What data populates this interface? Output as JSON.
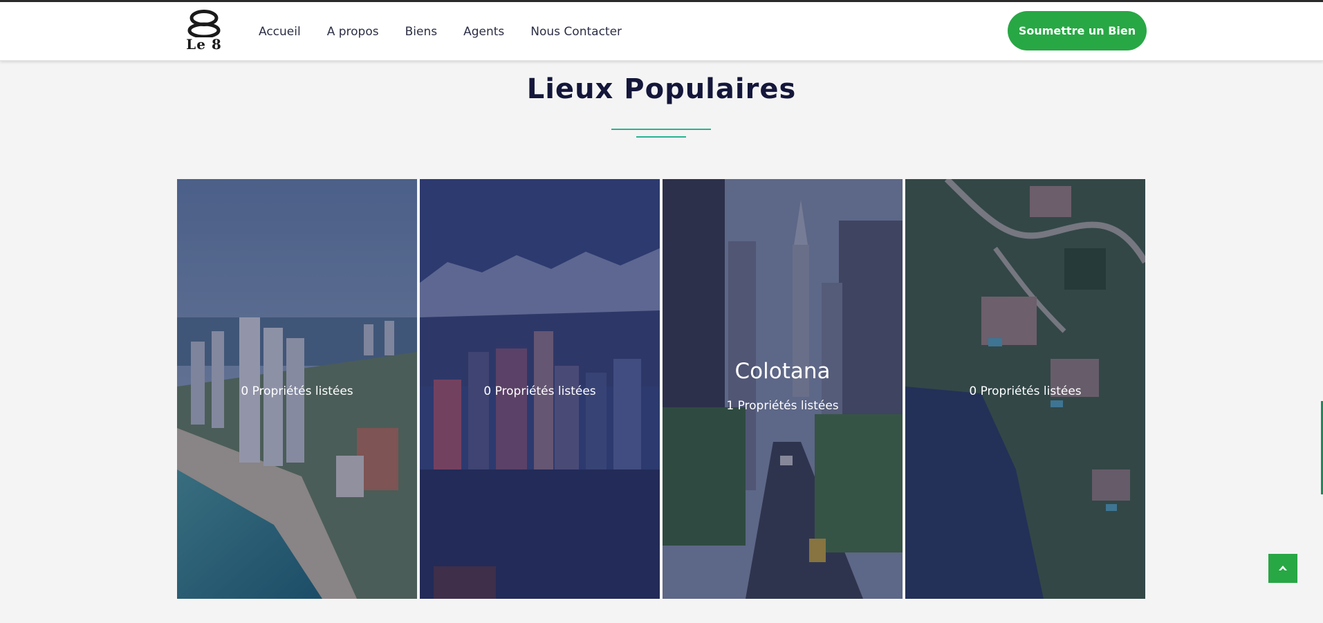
{
  "header": {
    "logo_text": "Le 8",
    "nav": [
      "Accueil",
      "A propos",
      "Biens",
      "Agents",
      "Nous Contacter"
    ],
    "submit_label": "Soumettre un Bien"
  },
  "section": {
    "title": "Lieux Populaires"
  },
  "cards": [
    {
      "name": "",
      "count": "0 Propriétés listées"
    },
    {
      "name": "",
      "count": "0 Propriétés listées"
    },
    {
      "name": "Colotana",
      "count": "1 Propriétés listées"
    },
    {
      "name": "",
      "count": "0 Propriétés listées"
    }
  ],
  "colors": {
    "accent": "#28a745",
    "title": "#14173a",
    "divider": "#27b38f"
  },
  "icons": {
    "scroll_top": "chevron-up-icon",
    "logo": "figure-eight-logo-icon"
  }
}
